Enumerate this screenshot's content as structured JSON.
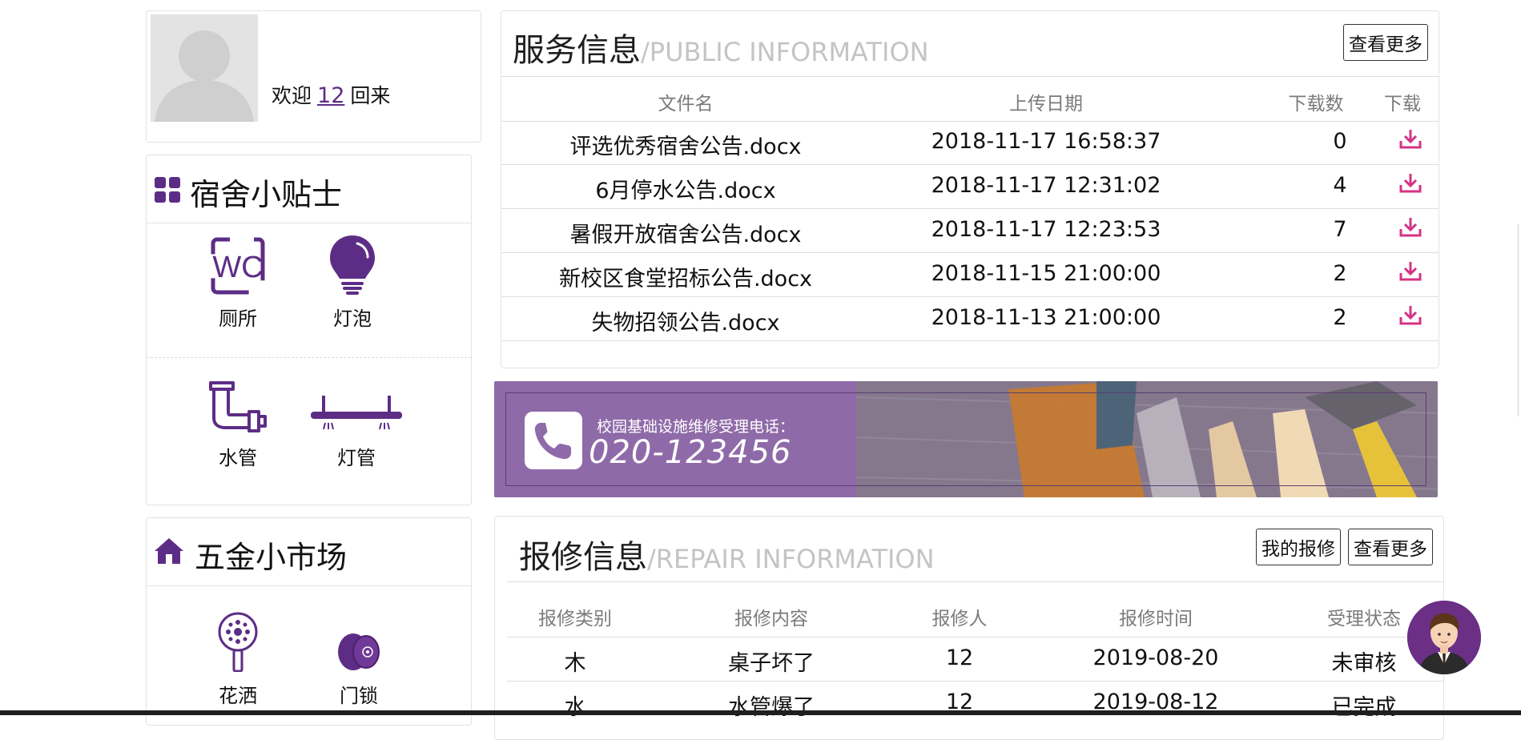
{
  "profile": {
    "welcome_prefix": "欢迎",
    "username": "12",
    "welcome_suffix": "回来"
  },
  "tips": {
    "title": "宿舍小贴士",
    "items": [
      {
        "label": "厕所",
        "icon": "wc-icon"
      },
      {
        "label": "灯泡",
        "icon": "light-bulb-icon"
      },
      {
        "label": "水管",
        "icon": "water-pipe-icon"
      },
      {
        "label": "灯管",
        "icon": "tube-light-icon"
      }
    ]
  },
  "market": {
    "title": "五金小市场",
    "items": [
      {
        "label": "花洒",
        "icon": "shower-head-icon"
      },
      {
        "label": "门锁",
        "icon": "door-lock-icon"
      }
    ]
  },
  "public_info": {
    "title": "服务信息",
    "subtitle": "/PUBLIC INFORMATION",
    "more_button": "查看更多",
    "columns": [
      "文件名",
      "上传日期",
      "下载数",
      "下载"
    ],
    "rows": [
      {
        "name": "评选优秀宿舍公告.docx",
        "date": "2018-11-17 16:58:37",
        "count": "0"
      },
      {
        "name": "6月停水公告.docx",
        "date": "2018-11-17 12:31:02",
        "count": "4"
      },
      {
        "name": "暑假开放宿舍公告.docx",
        "date": "2018-11-17 12:23:53",
        "count": "7"
      },
      {
        "name": "新校区食堂招标公告.docx",
        "date": "2018-11-15 21:00:00",
        "count": "2"
      },
      {
        "name": "失物招领公告.docx",
        "date": "2018-11-13 21:00:00",
        "count": "2"
      }
    ]
  },
  "banner": {
    "caption": "校园基础设施维修受理电话：",
    "phone": "020-123456"
  },
  "repair_info": {
    "title": "报修信息",
    "subtitle": "/REPAIR INFORMATION",
    "my_repairs_button": "我的报修",
    "more_button": "查看更多",
    "columns": [
      "报修类别",
      "报修内容",
      "报修人",
      "报修时间",
      "受理状态"
    ],
    "rows": [
      {
        "category": "木",
        "content": "桌子坏了",
        "person": "12",
        "time": "2019-08-20",
        "status": "未审核"
      },
      {
        "category": "水",
        "content": "水管爆了",
        "person": "12",
        "time": "2019-08-12",
        "status": "已完成"
      }
    ]
  },
  "colors": {
    "accent": "#5d2d86",
    "download": "#d63384",
    "banner": "#8f6aa8"
  }
}
